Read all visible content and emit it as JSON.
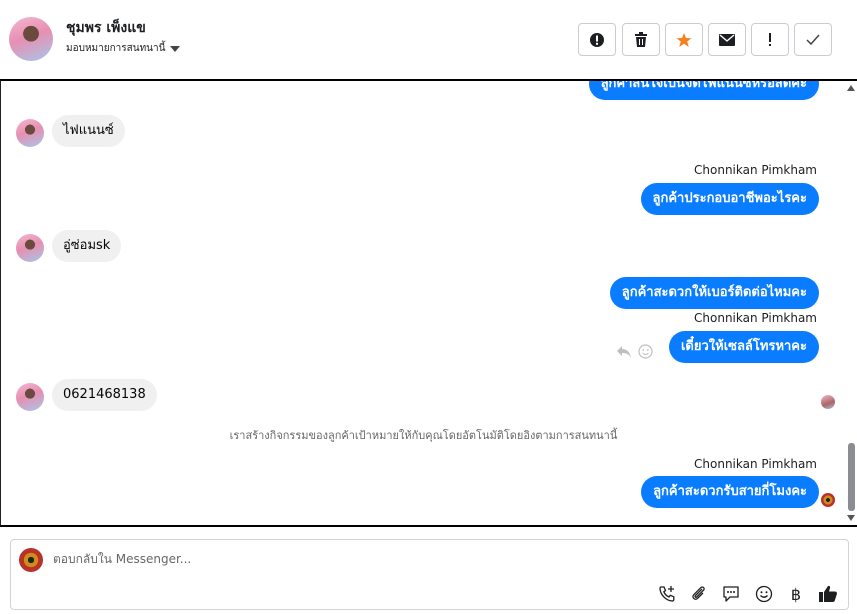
{
  "header": {
    "name": "ชุมพร เพ็งแข",
    "assign_label": "มอบหมายการสนทนานี้",
    "actions": [
      "spam",
      "delete",
      "star",
      "mark-unread",
      "important",
      "done"
    ]
  },
  "messages": {
    "m0": "ลูกค้าสนใจเป็นจดไฟแนนซ์หรือสดคะ",
    "m1": "ไฟแนนซ์",
    "m2_sender": "Chonnikan Pimkham",
    "m2": "ลูกค้าประกอบอาชีพอะไรคะ",
    "m3": "อู่ซ่อมsk",
    "m4": "ลูกค้าสะดวกให้เบอร์ติดต่อไหมคะ",
    "m5_sender": "Chonnikan Pimkham",
    "m5": "เดี๋ยวให้เซลล์โทรหาคะ",
    "m6": "0621468138",
    "system_note": "เราสร้างกิจกรรมของลูกค้าเป้าหมายให้กับคุณโดยอัตโนมัติโดยอิงตามการสนทนานี้",
    "m7_sender": "Chonnikan Pimkham",
    "m7": "ลูกค้าสะดวกรับสายกี่โมงคะ"
  },
  "composer": {
    "placeholder": "ตอบกลับใน Messenger...",
    "currency_symbol": "฿"
  },
  "colors": {
    "outgoing_bubble": "#0a7cff",
    "incoming_bubble": "#f0f0f0",
    "star": "#f5821f"
  }
}
